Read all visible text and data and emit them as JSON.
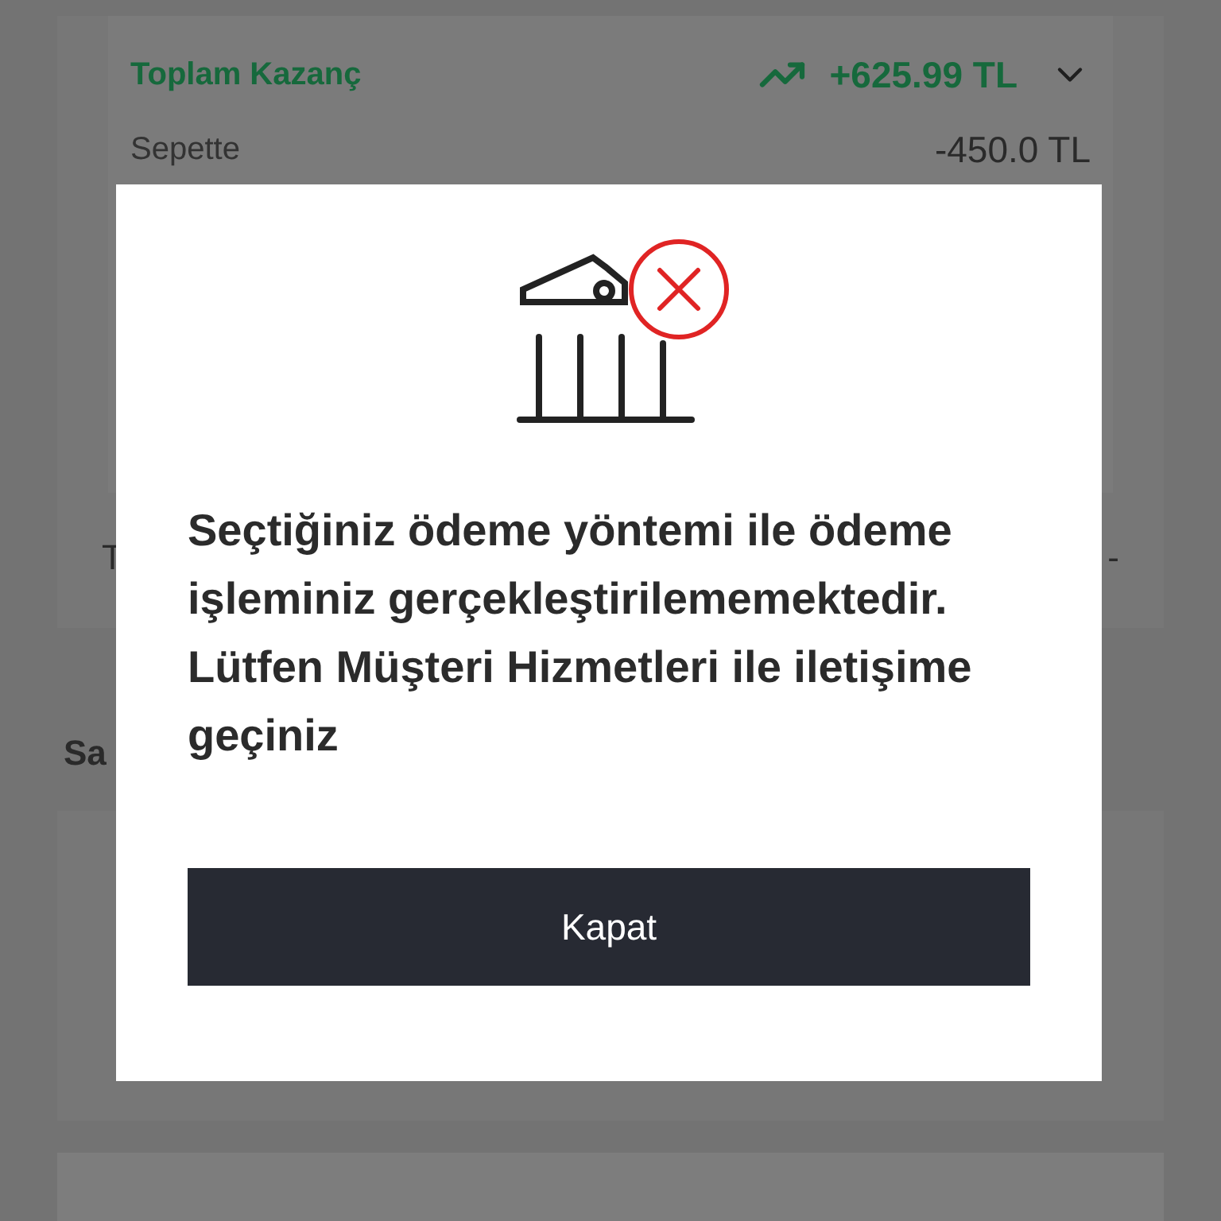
{
  "summary": {
    "total_label": "Toplam Kazanç",
    "total_value": "+625.99 TL",
    "expanded": false,
    "basket_label": "Sepette",
    "basket_value": "-450.0 TL",
    "row_label": "T",
    "row_value": "-"
  },
  "section": {
    "title": "Sa"
  },
  "dialog": {
    "message": "Seçtiğiniz ödeme yöntemi ile ödeme işleminiz gerçekleştirilememektedir. Lütfen Müşteri Hizmetleri ile iletişime geçiniz",
    "button": "Kapat"
  }
}
